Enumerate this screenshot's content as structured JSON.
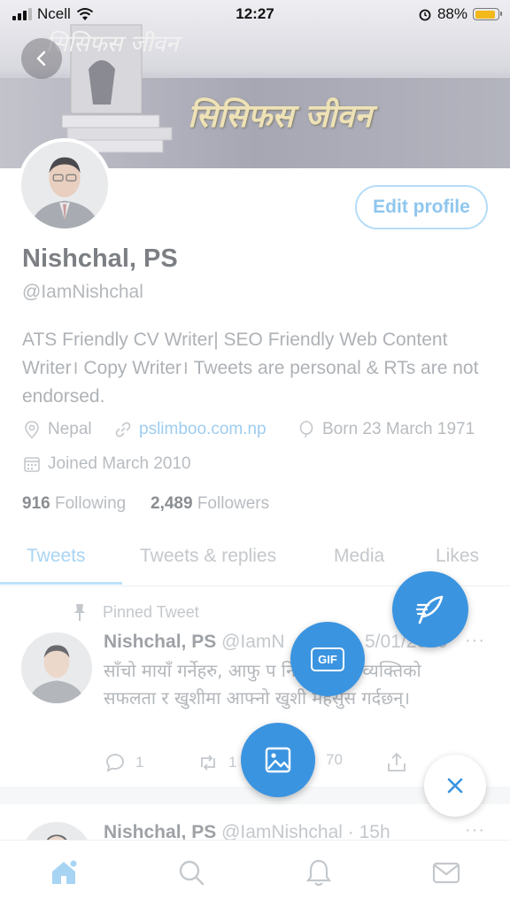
{
  "status_bar": {
    "carrier": "Ncell",
    "time": "12:27",
    "battery": "88%",
    "battery_level": 0.88
  },
  "header": {
    "banner_title": "सिसिफस जीवन",
    "book_title": "सिसिफस जीवन",
    "book_spine": "सिसिफस"
  },
  "profile": {
    "edit_label": "Edit profile",
    "name": "Nishchal, PS",
    "handle": "@IamNishchal",
    "bio": "ATS Friendly CV Writer| SEO Friendly Web Content Writer। Copy Writer। Tweets are personal & RTs are not endorsed.",
    "location": "Nepal",
    "website": "pslimboo.com.np",
    "born": "Born 23 March 1971",
    "joined": "Joined March 2010",
    "following_count": "916",
    "following_label": "Following",
    "followers_count": "2,489",
    "followers_label": "Followers"
  },
  "tabs": [
    {
      "label": "Tweets",
      "active": true
    },
    {
      "label": "Tweets & replies",
      "active": false
    },
    {
      "label": "Media",
      "active": false
    },
    {
      "label": "Likes",
      "active": false
    }
  ],
  "tweets": [
    {
      "pinned_label": "Pinned Tweet",
      "name": "Nishchal, PS",
      "handle": "@IamN",
      "date": "5/01/2020",
      "text": "साँचो मायाँ गर्नेहरु, आफु प      नि मायाँ गर्ने व्यक्तिको सफलता र खुशीमा आफ्नो खुशी महसुस गर्दछन्।",
      "replies": "1",
      "retweets": "1",
      "likes": "70",
      "more": "···"
    },
    {
      "name": "Nishchal, PS",
      "handle": "@IamNishchal",
      "time": "· 15h",
      "more": "···"
    }
  ],
  "fab": {
    "gif_label": "GIF"
  },
  "bottom_nav": [
    "home-icon",
    "search-icon",
    "notifications-icon",
    "messages-icon"
  ],
  "colors": {
    "accent": "#3b94e0",
    "link": "#9fcdf0",
    "battery": "#f3b81b"
  }
}
